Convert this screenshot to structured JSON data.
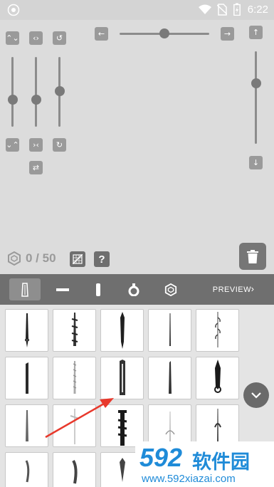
{
  "status_bar": {
    "time": "6:22",
    "icons": [
      "app-notification-icon",
      "wifi-icon",
      "no-sim-icon",
      "battery-charging-icon"
    ]
  },
  "counter": {
    "text": "0 / 50",
    "icon": "hexagon-gem-icon"
  },
  "help_label": "?",
  "toolbar": {
    "tabs": [
      "handle-tab",
      "guard-tab",
      "grip-tab",
      "pommel-tab",
      "gem-tab"
    ],
    "selected_tab": "handle-tab",
    "preview_label": "PREVIEW",
    "preview_chevron": "›"
  },
  "grid": {
    "items": [
      "handle-1",
      "handle-2",
      "handle-3",
      "handle-4",
      "handle-5",
      "handle-6",
      "handle-7",
      "handle-8",
      "handle-9",
      "handle-10",
      "handle-11",
      "handle-12",
      "handle-13",
      "handle-14",
      "handle-15",
      "handle-16",
      "handle-17",
      "handle-18",
      "handle-19",
      "handle-20"
    ]
  },
  "watermark": {
    "number": "592",
    "brand": "软件园",
    "url": "www.592xiazai.com"
  }
}
